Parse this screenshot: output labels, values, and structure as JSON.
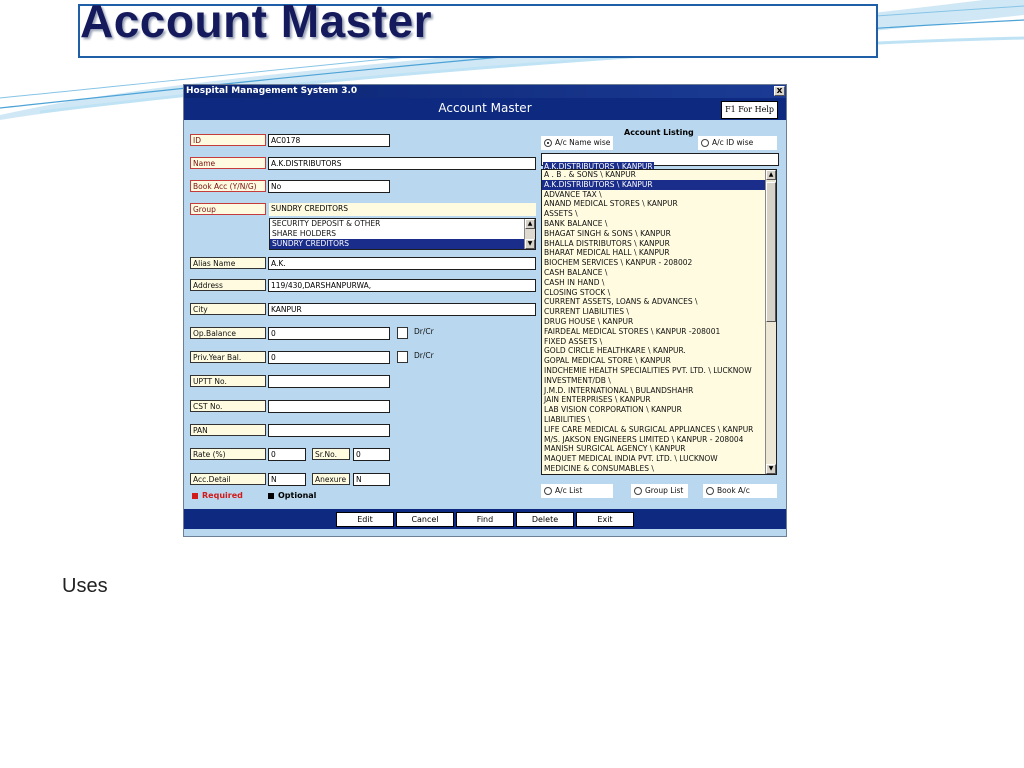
{
  "slide": {
    "title": "Account Master",
    "caption": "Uses"
  },
  "window": {
    "title": "Hospital Management System 3.0",
    "close": "x",
    "header": "Account Master",
    "help": "F1 For Help"
  },
  "form": {
    "id": {
      "label": "ID",
      "value": "AC0178"
    },
    "name": {
      "label": "Name",
      "value": "A.K.DISTRIBUTORS"
    },
    "book_acc": {
      "label": "Book Acc (Y/N/G)",
      "value": "No"
    },
    "group": {
      "label": "Group",
      "value": "SUNDRY CREDITORS",
      "options": [
        "SECURITY DEPOSIT & OTHER",
        "SHARE HOLDERS",
        "SUNDRY CREDITORS"
      ],
      "selected_index": 2
    },
    "alias": {
      "label": "Alias Name",
      "value": "A.K."
    },
    "address": {
      "label": "Address",
      "value": "119/430,DARSHANPURWA,"
    },
    "city": {
      "label": "City",
      "value": "KANPUR"
    },
    "op_balance": {
      "label": "Op.Balance",
      "value": "0",
      "drcr": "Dr/Cr"
    },
    "priv_year_bal": {
      "label": "Priv.Year Bal.",
      "value": "0",
      "drcr": "Dr/Cr"
    },
    "uptt": {
      "label": "UPTT No.",
      "value": ""
    },
    "cst": {
      "label": "CST No.",
      "value": ""
    },
    "pan": {
      "label": "PAN",
      "value": ""
    },
    "rate": {
      "label": "Rate (%)",
      "value": "0"
    },
    "srno": {
      "label": "Sr.No.",
      "value": "0"
    },
    "acc_detail": {
      "label": "Acc.Detail",
      "value": "N"
    },
    "anexure": {
      "label": "Anexure",
      "value": "N"
    }
  },
  "legend": {
    "required": "Required",
    "optional": "Optional",
    "required_color": "#d11a1a",
    "optional_color": "#000000"
  },
  "account_listing": {
    "title": "Account Listing",
    "sort_name": "A/c Name wise",
    "sort_id": "A/c ID wise",
    "search_value": "A.K.DISTRIBUTORS \\ KANPUR",
    "selected_index": 1,
    "items": [
      "A . B . & SONS \\ KANPUR",
      "A.K.DISTRIBUTORS \\ KANPUR",
      "ADVANCE TAX \\",
      "ANAND MEDICAL STORES \\ KANPUR",
      "ASSETS \\",
      "BANK BALANCE \\",
      "BHAGAT SINGH & SONS \\ KANPUR",
      "BHALLA DISTRIBUTORS \\ KANPUR",
      "BHARAT MEDICAL HALL \\ KANPUR",
      "BIOCHEM SERVICES \\ KANPUR - 208002",
      "CASH BALANCE \\",
      "CASH IN HAND \\",
      "CLOSING STOCK \\",
      "CURRENT ASSETS, LOANS & ADVANCES \\",
      "CURRENT LIABILITIES \\",
      "DRUG HOUSE \\ KANPUR",
      "FAIRDEAL MEDICAL STORES \\ KANPUR -208001",
      "FIXED ASSETS \\",
      "GOLD CIRCLE HEALTHKARE \\ KANPUR.",
      "GOPAL MEDICAL STORE \\ KANPUR",
      "INDCHEMIE HEALTH SPECIALITIES PVT. LTD. \\ LUCKNOW",
      "INVESTMENT/DB \\",
      "J.M.D. INTERNATIONAL \\ BULANDSHAHR",
      "JAIN ENTERPRISES \\ KANPUR",
      "LAB VISION CORPORATION \\ KANPUR",
      "LIABILITIES \\",
      "LIFE CARE MEDICAL & SURGICAL APPLIANCES \\ KANPUR",
      "M/S. JAKSON ENGINEERS LIMITED \\ KANPUR - 208004",
      "MANISH SURGICAL AGENCY \\ KANPUR",
      "MAQUET MEDICAL INDIA PVT. LTD. \\ LUCKNOW",
      "MEDICINE & CONSUMABLES \\"
    ],
    "list_types": [
      "A/c List",
      "Group List",
      "Book A/c"
    ]
  },
  "buttons": [
    "Edit",
    "Cancel",
    "Find",
    "Delete",
    "Exit"
  ]
}
